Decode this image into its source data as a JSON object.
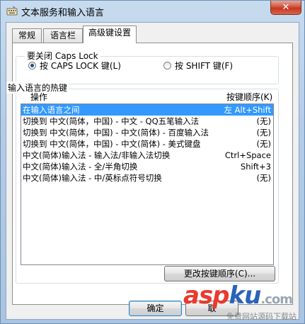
{
  "window": {
    "title": "文本服务和输入语言",
    "close_label": "✕"
  },
  "tabs": [
    {
      "label": "常规"
    },
    {
      "label": "语言栏"
    },
    {
      "label": "高级键设置"
    }
  ],
  "caps_lock": {
    "group_title": "要关闭 Caps Lock",
    "options": [
      {
        "label": "按 CAPS LOCK 键(L)",
        "checked": true
      },
      {
        "label": "按 SHIFT 键(F)",
        "checked": false
      }
    ]
  },
  "hotkeys": {
    "group_title": "输入语言的热键",
    "column_action": "操作",
    "column_keys": "按键顺序(K)",
    "rows": [
      {
        "action": "在输入语言之间",
        "keys": "左 Alt+Shift",
        "selected": true
      },
      {
        "action": "切换到 中文(简体，中国) - 中文 - QQ五笔输入法",
        "keys": "(无)"
      },
      {
        "action": "切换到 中文(简体，中国) - 中文(简体) - 百度输入法",
        "keys": "(无)"
      },
      {
        "action": "切换到 中文(简体，中国) - 中文(简体) - 美式键盘",
        "keys": "(无)"
      },
      {
        "action": "中文(简体)输入法 - 输入法/非输入法切换",
        "keys": "Ctrl+Space"
      },
      {
        "action": "中文(简体)输入法 - 全/半角切换",
        "keys": "Shift+3"
      },
      {
        "action": "中文(简体)输入法 - 中/英标点符号切换",
        "keys": "(无)"
      }
    ],
    "change_button": "更改按键顺序(C)..."
  },
  "footer": {
    "ok_button": "确定",
    "cancel_button": "取"
  },
  "watermark": {
    "brand_a": "asp",
    "brand_b": "ku",
    "brand_c": ".com",
    "tagline": "免费网站源码下载站"
  },
  "colors": {
    "selection": "#3399ff",
    "close_button": "#c4371f",
    "title_bar": "#b3cce6"
  }
}
